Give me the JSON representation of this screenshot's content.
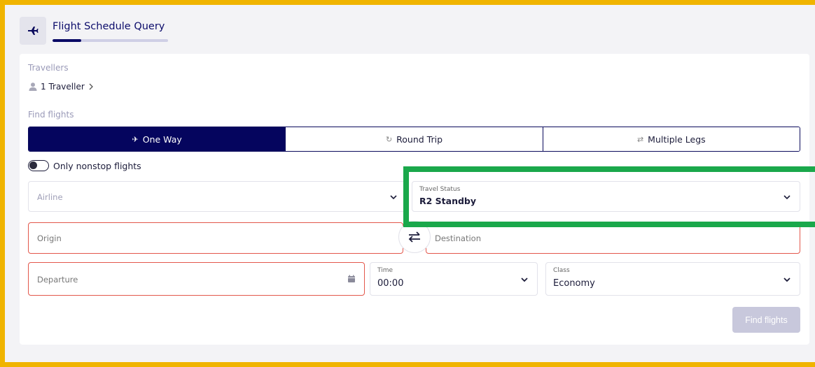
{
  "header": {
    "title": "Flight Schedule Query",
    "progress": 0.25
  },
  "travellers": {
    "label": "Travellers",
    "value": "1 Traveller"
  },
  "find_flights": {
    "label": "Find flights",
    "tabs": [
      {
        "label": "One Way",
        "icon": "plane-takeoff-icon",
        "active": true
      },
      {
        "label": "Round Trip",
        "icon": "refresh-icon",
        "active": false
      },
      {
        "label": "Multiple Legs",
        "icon": "swap-arrows-icon",
        "active": false
      }
    ]
  },
  "nonstop": {
    "label": "Only nonstop flights",
    "on": false
  },
  "airline": {
    "placeholder": "Airline"
  },
  "travel_status": {
    "label": "Travel Status",
    "value": "R2 Standby"
  },
  "origin": {
    "placeholder": "Origin"
  },
  "destination": {
    "placeholder": "Destination"
  },
  "departure": {
    "placeholder": "Departure"
  },
  "time": {
    "label": "Time",
    "value": "00:00"
  },
  "class": {
    "label": "Class",
    "value": "Economy"
  },
  "find_button": {
    "label": "Find flights"
  },
  "colors": {
    "accent": "#05055e",
    "error": "#e3574b",
    "outer_border": "#f0b400",
    "highlight": "#1aa84b"
  }
}
